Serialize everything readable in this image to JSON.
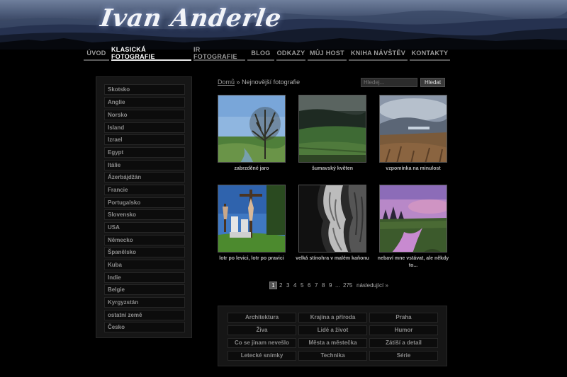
{
  "site": {
    "logo_text": "Ivan Anderle"
  },
  "nav": [
    {
      "label": "ÚVOD",
      "active": false
    },
    {
      "label": "KLASICKÁ FOTOGRAFIE",
      "active": true
    },
    {
      "label": "IR FOTOGRAFIE",
      "active": false
    },
    {
      "label": "BLOG",
      "active": false
    },
    {
      "label": "ODKAZY",
      "active": false
    },
    {
      "label": "MŮJ HOST",
      "active": false
    },
    {
      "label": "KNIHA NÁVŠTĚV",
      "active": false
    },
    {
      "label": "KONTAKTY",
      "active": false
    }
  ],
  "sidebar": {
    "items": [
      "Skotsko",
      "Anglie",
      "Norsko",
      "Island",
      "Izrael",
      "Egypt",
      "Itálie",
      "Ázerbájdžán",
      "Francie",
      "Portugalsko",
      "Slovensko",
      "USA",
      "Německo",
      "Španělsko",
      "Kuba",
      "Indie",
      "Belgie",
      "Kyrgyzstán",
      "ostatní země",
      "Česko"
    ]
  },
  "breadcrumb": {
    "home": "Domů",
    "separator": "»",
    "current": "Nejnovější fotografie"
  },
  "search": {
    "placeholder": "Hledej...",
    "button": "Hledat"
  },
  "gallery": [
    {
      "caption": "zabrzděné jaro",
      "image": "bare-tree-meadow"
    },
    {
      "caption": "šumavský květen",
      "image": "green-hills-forest"
    },
    {
      "caption": "vzpomínka na minulost",
      "image": "misty-valley-lake"
    },
    {
      "caption": "lotr po levici, lotr po pravici",
      "image": "crucifix-statues"
    },
    {
      "caption": "velká stínohra v malém kaňonu",
      "image": "canyon-rock-bw"
    },
    {
      "caption": "nebaví mne vstávat, ale někdy to...",
      "image": "purple-dawn-stream"
    }
  ],
  "pagination": {
    "current": "1",
    "pages": [
      "2",
      "3",
      "4",
      "5",
      "6",
      "7",
      "8",
      "9"
    ],
    "ellipsis": "...",
    "last": "275",
    "next": "následující »"
  },
  "categories": [
    "Architektura",
    "Krajina a příroda",
    "Praha",
    "Živa",
    "Lidé a život",
    "Humor",
    "Co se jinam nevešlo",
    "Města a městečka",
    "Zátiší a detail",
    "Letecké snímky",
    "Technika",
    "Série"
  ]
}
